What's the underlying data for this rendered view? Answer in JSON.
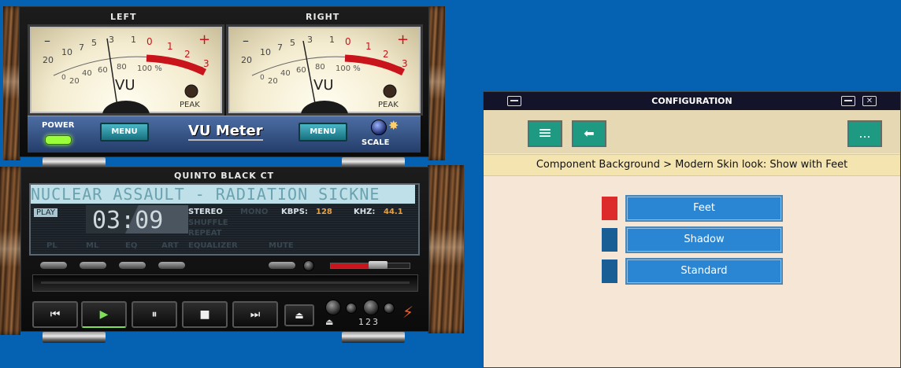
{
  "vu_meter": {
    "left_label": "LEFT",
    "right_label": "RIGHT",
    "scale_top": [
      "20",
      "10",
      "7",
      "5",
      "3",
      "1",
      "0",
      "1",
      "2",
      "3"
    ],
    "minus_sign": "–",
    "plus_sign": "+",
    "scale_bottom": [
      "0",
      "20",
      "40",
      "60",
      "80",
      "100 %"
    ],
    "vu_text": "VU",
    "peak_label": "PEAK",
    "power_label": "POWER",
    "menu_label": "MENU",
    "title": "VU Meter",
    "scale_label": "SCALE",
    "colors": {
      "red_zone": "#c8141a",
      "power_led": "#9aff3a"
    }
  },
  "player": {
    "skin_title": "QUINTO BLACK CT",
    "track_title": "NUCLEAR ASSAULT - RADIATION SICKNE",
    "status": "PLAY",
    "time": "03:09",
    "stereo": "STEREO",
    "mono": "MONO",
    "kbps_label": "KBPS:",
    "kbps_value": "128",
    "khz_label": "KHZ:",
    "khz_value": "44.1",
    "shuffle": "SHUFFLE",
    "repeat": "REPEAT",
    "equalizer": "EQUALIZER",
    "mute": "MUTE",
    "bottom_labels": [
      "PL",
      "ML",
      "EQ",
      "ART"
    ],
    "volume_percent": 60,
    "transport": {
      "prev": "⏮",
      "play": "▶",
      "pause": "⏸",
      "stop": "■",
      "next": "⏭",
      "eject": "⏏"
    },
    "digits_label": "123"
  },
  "config": {
    "title": "CONFIGURATION",
    "menu_icon": "≡",
    "back_icon": "⬅",
    "more_label": "...",
    "breadcrumb": "Component Background > Modern Skin look: Show with Feet",
    "options": [
      {
        "label": "Feet",
        "swatch": "#dd2a2a"
      },
      {
        "label": "Shadow",
        "swatch": "#1a5e96"
      },
      {
        "label": "Standard",
        "swatch": "#1a5e96"
      }
    ]
  }
}
